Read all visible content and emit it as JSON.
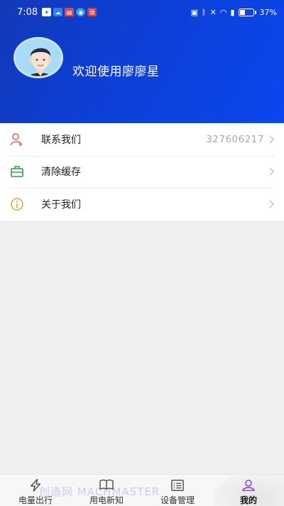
{
  "status_bar": {
    "time": "7:08",
    "battery": "37%",
    "notification_icons": [
      "weather-icon",
      "cloud-icon",
      "app-red-icon",
      "browser-icon",
      "news-icon"
    ],
    "notif_colors": [
      "#ffffff",
      "#2f80ed",
      "#e64545",
      "#3a9ad9",
      "#d43b3b"
    ],
    "notif_glyph_news": "頭"
  },
  "header": {
    "welcome_text": "欢迎使用廖廖星",
    "gradient_colors": [
      "#1239b8",
      "#0a47ee"
    ]
  },
  "menu": {
    "items": [
      {
        "label": "联系我们",
        "value": "327606217",
        "icon": "contact-person-icon",
        "icon_color": "#e06060"
      },
      {
        "label": "清除缓存",
        "value": "",
        "icon": "clear-cache-icon",
        "icon_color": "#2e9e4a"
      },
      {
        "label": "关于我们",
        "value": "",
        "icon": "info-icon",
        "icon_color": "#d4a72c"
      }
    ]
  },
  "tabbar": {
    "tabs": [
      {
        "label": "电量出行",
        "icon": "lightning-icon",
        "active": false
      },
      {
        "label": "用电新知",
        "icon": "book-icon",
        "active": false
      },
      {
        "label": "设备管理",
        "icon": "list-icon",
        "active": false
      },
      {
        "label": "我的",
        "icon": "user-icon",
        "active": true,
        "active_color": "#7a3cd6"
      }
    ]
  },
  "watermark": "创造网 MACHMASTER"
}
